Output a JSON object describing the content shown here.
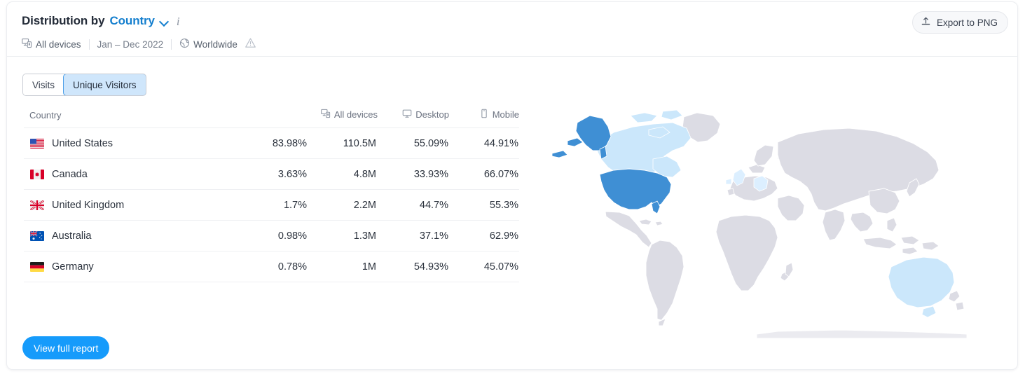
{
  "header": {
    "title_prefix": "Distribution by",
    "dimension": "Country",
    "dropdown_icon": "chevron-down-icon",
    "info_icon": "info-icon",
    "export_label": "Export to PNG",
    "export_icon": "upload-icon",
    "meta": {
      "devices": "All devices",
      "devices_icon": "all-devices-icon",
      "date_range": "Jan – Dec 2022",
      "location": "Worldwide",
      "location_icon": "globe-icon",
      "warning_icon": "warning-triangle-icon"
    }
  },
  "toggle": {
    "options": [
      "Visits",
      "Unique Visitors"
    ],
    "selected": "Unique Visitors"
  },
  "table": {
    "columns": [
      {
        "label": "Country",
        "icon": null
      },
      {
        "label": "",
        "icon": null
      },
      {
        "label": "All devices",
        "icon": "all-devices-icon"
      },
      {
        "label": "Desktop",
        "icon": "desktop-icon"
      },
      {
        "label": "Mobile",
        "icon": "mobile-icon"
      }
    ],
    "rows": [
      {
        "country": "United States",
        "flag": "us",
        "share": "83.98%",
        "total": "110.5M",
        "desktop": "55.09%",
        "mobile": "44.91%"
      },
      {
        "country": "Canada",
        "flag": "ca",
        "share": "3.63%",
        "total": "4.8M",
        "desktop": "33.93%",
        "mobile": "66.07%"
      },
      {
        "country": "United Kingdom",
        "flag": "gb",
        "share": "1.7%",
        "total": "2.2M",
        "desktop": "44.7%",
        "mobile": "55.3%"
      },
      {
        "country": "Australia",
        "flag": "au",
        "share": "0.98%",
        "total": "1.3M",
        "desktop": "37.1%",
        "mobile": "62.9%"
      },
      {
        "country": "Germany",
        "flag": "de",
        "share": "0.78%",
        "total": "1M",
        "desktop": "54.93%",
        "mobile": "45.07%"
      }
    ]
  },
  "footer": {
    "report_label": "View full report"
  },
  "map": {
    "highlights": [
      {
        "country": "United States",
        "color": "#3f8fd4"
      },
      {
        "country": "Canada",
        "color": "#cbe7fb"
      },
      {
        "country": "Australia",
        "color": "#cbe7fb"
      },
      {
        "country": "United Kingdom",
        "color": "#dcefff"
      },
      {
        "country": "Germany",
        "color": "#dcefff"
      }
    ],
    "base_land_color": "#dcdce4",
    "background_color": "#ffffff"
  },
  "colors": {
    "accent_blue": "#157fce",
    "button_blue": "#169bfb",
    "desktop_green": "#2eb79a",
    "mobile_orange": "#eb8b4c",
    "muted_text": "#747c89"
  }
}
